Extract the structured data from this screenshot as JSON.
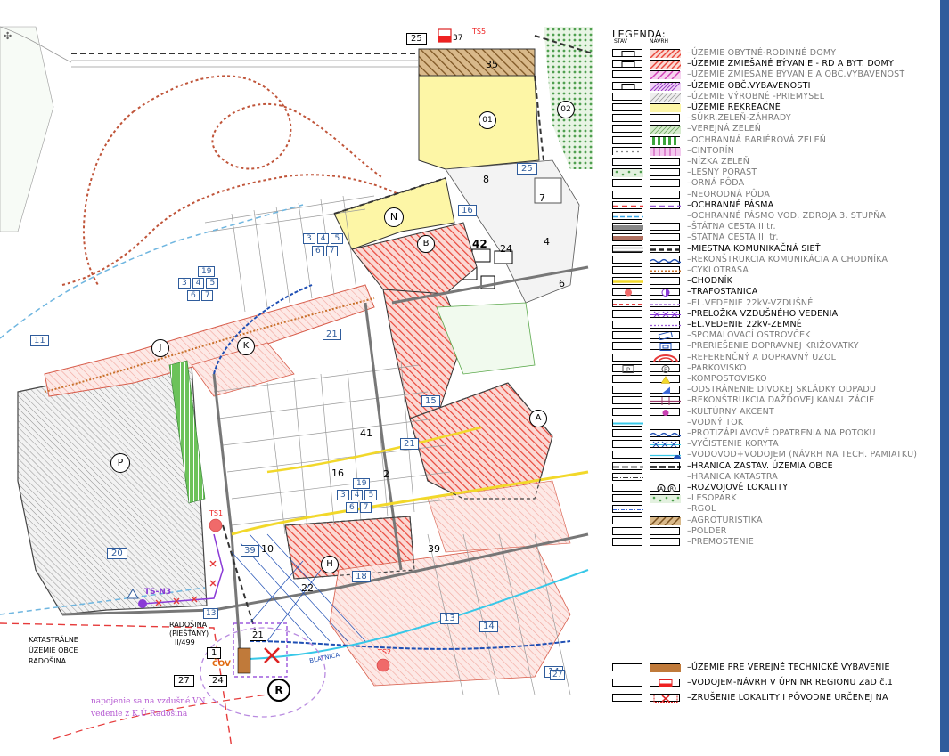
{
  "legend": {
    "title": "LEGENDA:",
    "col_stav": "STAV",
    "col_navrh": "NÁVRH",
    "items": [
      {
        "label": "ÚZEMIE OBYTNÉ-RODINNÉ DOMY",
        "bold": false,
        "stav": "box",
        "navrh": "hatch-red"
      },
      {
        "label": "ÚZEMIE ZMIEŠANÉ BÝVANIE - RD A BYT. DOMY",
        "bold": true,
        "stav": "box",
        "navrh": "hatch-red"
      },
      {
        "label": "ÚZEMIE ZMIEŠANÉ BÝVANIE A OBČ.VYBAVENOSŤ",
        "bold": false,
        "stav": "plain",
        "navrh": "hatch-magenta"
      },
      {
        "label": "ÚZEMIE OBČ.VYBAVENOSTI",
        "bold": true,
        "stav": "box",
        "navrh": "hatch-purple"
      },
      {
        "label": "ÚZEMIE VÝROBNÉ -PRIEMYSEL",
        "bold": false,
        "stav": "plain",
        "navrh": "hatch-grey"
      },
      {
        "label": "ÚZEMIE REKREAČNÉ",
        "bold": true,
        "stav": "plain",
        "navrh": "yellow"
      },
      {
        "label": "SÚKR.ZELEŇ-ZÁHRADY",
        "bold": false,
        "stav": "plain",
        "navrh": "plain"
      },
      {
        "label": "VEREJNÁ ZELEŇ",
        "bold": false,
        "stav": "plain",
        "navrh": "hatch-green"
      },
      {
        "label": "OCHRANNÁ BARIÉROVÁ ZELEŇ",
        "bold": false,
        "stav": "plain",
        "navrh": "bars-green"
      },
      {
        "label": "CINTORÍN",
        "bold": false,
        "stav": "dots",
        "navrh": "hatch-pink"
      },
      {
        "label": "NÍZKA ZELEŇ",
        "bold": false,
        "stav": "plain",
        "navrh": "plain"
      },
      {
        "label": "LESNÝ PORAST",
        "bold": false,
        "stav": "forest",
        "navrh": "plain"
      },
      {
        "label": "ORNÁ PÔDA",
        "bold": false,
        "stav": "plain",
        "navrh": "plain"
      },
      {
        "label": "NEORODNÁ PÔDA",
        "bold": false,
        "stav": "plain",
        "navrh": "plain"
      },
      {
        "label": "OCHRANNÉ PÁSMA",
        "bold": true,
        "stav": "line-red-dash",
        "navrh": "line-purple-dash"
      },
      {
        "label": "OCHRANNÉ PÁSMO VOD. ZDROJA 3. STUPŇA",
        "bold": false,
        "stav": "line-cyan-dash",
        "navrh": "none"
      },
      {
        "label": "ŠTÁTNA CESTA II tr.",
        "bold": false,
        "stav": "road-grey",
        "navrh": "plain"
      },
      {
        "label": "ŠTÁTNA CESTA III tr.",
        "bold": false,
        "stav": "road-brown",
        "navrh": "plain"
      },
      {
        "label": "MIESTNA KOMUNIKAČNÁ SIEŤ",
        "bold": true,
        "stav": "road-double",
        "navrh": "road-dash"
      },
      {
        "label": "REKONŠTRUKCIA KOMUNIKÁCIA A CHODNÍKA",
        "bold": false,
        "stav": "plain",
        "navrh": "wave-blue"
      },
      {
        "label": "CYKLOTRASA",
        "bold": false,
        "stav": "plain",
        "navrh": "line-orange-dot"
      },
      {
        "label": "CHODNÍK",
        "bold": true,
        "stav": "line-yellow",
        "navrh": "plain"
      },
      {
        "label": "TRAFOSTANICA",
        "bold": true,
        "stav": "circle-red",
        "navrh": "circle-purple"
      },
      {
        "label": "EL.VEDENIE 22kV-VZDUŠNÉ",
        "bold": false,
        "stav": "arrow-red",
        "navrh": "line-purple"
      },
      {
        "label": "PRELOŽKA VZDUŠNÉHO VEDENIA",
        "bold": true,
        "stav": "plain",
        "navrh": "cross-purple"
      },
      {
        "label": "EL.VEDENIE 22kV-ZEMNÉ",
        "bold": true,
        "stav": "plain",
        "navrh": "dot-purple"
      },
      {
        "label": "SPOMALOVACÍ OSTROVČEK",
        "bold": false,
        "stav": "plain",
        "navrh": "island-blue"
      },
      {
        "label": "PRERIEŠENIE DOPRAVNEJ KRIŽOVATKY",
        "bold": false,
        "stav": "plain",
        "navrh": "square-blue"
      },
      {
        "label": "REFERENČNÝ A DOPRAVNÝ UZOL",
        "bold": false,
        "stav": "plain",
        "navrh": "arc-red"
      },
      {
        "label": "PARKOVISKO",
        "bold": false,
        "stav": "p-box",
        "navrh": "p-circle"
      },
      {
        "label": "KOMPOSTOVISKO",
        "bold": false,
        "stav": "plain",
        "navrh": "tri-yellow"
      },
      {
        "label": "ODSTRÁNENIE DIVOKEJ SKLÁDKY ODPADU",
        "bold": false,
        "stav": "plain",
        "navrh": "tri-blue"
      },
      {
        "label": "REKONŠTRUKCIA DAŽĎOVEJ KANALIZÁCIE",
        "bold": false,
        "stav": "plain",
        "navrh": "h-purple"
      },
      {
        "label": "KULTÚRNY AKCENT",
        "bold": false,
        "stav": "plain",
        "navrh": "dot-magenta"
      },
      {
        "label": "VODNÝ TOK",
        "bold": false,
        "stav": "line-cyan",
        "navrh": "none"
      },
      {
        "label": "PROTIZÁPLAVOVÉ OPATRENIA NA POTOKU",
        "bold": false,
        "stav": "plain",
        "navrh": "wave-blue"
      },
      {
        "label": "VYČISTENIE KORYTA",
        "bold": false,
        "stav": "plain",
        "navrh": "cross-blue"
      },
      {
        "label": "VODOVOD+VODOJEM (NÁVRH NA TECH. PAMIATKU)",
        "bold": false,
        "stav": "plain",
        "navrh": "vodojem"
      },
      {
        "label": "HRANICA ZASTAV. ÚZEMIA OBCE",
        "bold": true,
        "stav": "line-grey-dash",
        "navrh": "line-black-dash"
      },
      {
        "label": "HRANICA KATASTRA",
        "bold": false,
        "stav": "line-dashdot",
        "navrh": "none"
      },
      {
        "label": "ROZVOJOVÉ LOKALITY",
        "bold": true,
        "stav": "plain",
        "navrh": "ar-circles"
      },
      {
        "label": "LESOPARK",
        "bold": false,
        "stav": "plain",
        "navrh": "forest"
      },
      {
        "label": "RGOL",
        "bold": false,
        "stav": "line-blue-dash",
        "navrh": "none"
      },
      {
        "label": "AGROTURISTIKA",
        "bold": false,
        "stav": "plain",
        "navrh": "hatch-brown"
      },
      {
        "label": "POLDER",
        "bold": false,
        "stav": "plain",
        "navrh": "plain"
      },
      {
        "label": "PREMOSTENIE",
        "bold": false,
        "stav": "plain",
        "navrh": "plain"
      }
    ],
    "extra": [
      {
        "label": "ÚZEMIE PRE VEREJNÉ TECHNICKÉ VYBAVENIE",
        "bold": true,
        "navrh": "brown-fill"
      },
      {
        "label": "VODOJEM-NÁVRH V ÚPN NR REGIONU ZaD č.1",
        "bold": true,
        "navrh": "red-square"
      },
      {
        "label": "ZRUŠENIE LOKALITY I PÔVODNE URČENEJ NA",
        "bold": true,
        "navrh": "red-x"
      }
    ]
  },
  "map": {
    "locality_labels": [
      "01",
      "02",
      "N",
      "B",
      "K",
      "J",
      "P",
      "H",
      "A",
      "R"
    ],
    "numbers": [
      "35",
      "25",
      "8",
      "16",
      "7",
      "4",
      "42",
      "24",
      "6",
      "11",
      "21",
      "15",
      "41",
      "16",
      "2",
      "21",
      "19",
      "20",
      "10",
      "39",
      "22",
      "18",
      "13",
      "14",
      "27",
      "24",
      "1",
      "21",
      "8"
    ],
    "parcel_grid": [
      "19",
      "3",
      "4",
      "5",
      "6",
      "7"
    ],
    "top_boxes": [
      "25",
      "37"
    ],
    "top_label": "TS5",
    "ts_labels": [
      "TS1",
      "TS2",
      "TS-N3"
    ],
    "road_label_line1": "RADOŠINA",
    "road_label_line2": "(PIEŠŤANY)",
    "road_label_line3": "II/499",
    "katastre_line1": "KATASTRÁLNE",
    "katastre_line2": "ÚZEMIE OBCE",
    "katastre_line3": "RADOŠINA",
    "cov_label": "ČOV",
    "stream_label": "BLATNICA",
    "note_line1": "napojenie sa na vzdušné VN",
    "note_line2": "vedenie z K.Ú Radošina"
  },
  "colors": {
    "residential": "#f06a5e",
    "residential_light": "#f8c9c4",
    "recreation": "#fdf6a6",
    "green": "#5aa84a",
    "road": "#8a8a8a",
    "boundary": "#555555",
    "blue": "#1f4fb4",
    "purple": "#8a3ad6",
    "cyan": "#38c8e8",
    "frame": "#2f5c9c"
  }
}
